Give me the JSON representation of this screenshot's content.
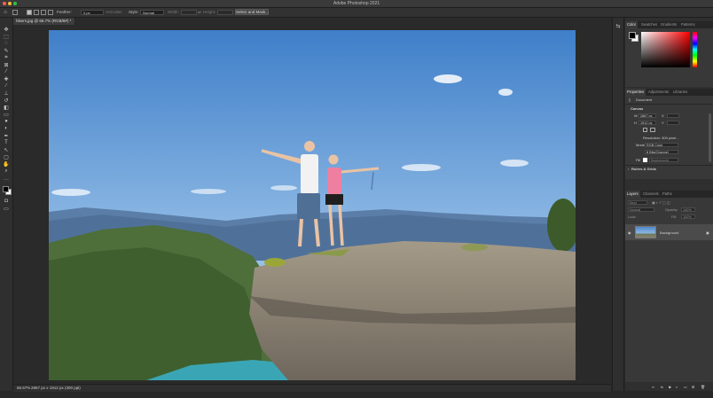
{
  "window": {
    "title": "Adobe Photoshop 2021",
    "traffic_colors": [
      "#ff5f57",
      "#febc2e",
      "#28c840"
    ]
  },
  "options_bar": {
    "feather_label": "Feather:",
    "feather_value": "0 px",
    "anti_alias_label": "Anti-alias",
    "style_label": "Style:",
    "style_value": "Normal",
    "width_label": "Width:",
    "height_label": "Height:",
    "select_and_mask_label": "Select and Mask..."
  },
  "document": {
    "tab_label": "hikers.jpg @ 66.7% (RGB/8#) *",
    "zoom": "66.67%",
    "status_info": "2867 px x 1912 px (300 ppi)"
  },
  "color_panel": {
    "tabs": [
      "Color",
      "Swatches",
      "Gradients",
      "Patterns"
    ],
    "active_tab": "Color",
    "foreground": "#000000",
    "background": "#ffffff",
    "hue": "#ff0000"
  },
  "properties_panel": {
    "tabs": [
      "Properties",
      "Adjustments",
      "Libraries"
    ],
    "active_tab": "Properties",
    "type_label": "Document",
    "canvas_section": "Canvas",
    "w_label": "W",
    "w_value": "2867 px",
    "h_label": "H",
    "h_value": "1912 px",
    "x_label": "X",
    "y_label": "Y",
    "resolution": "Resolution: 300 pixel...",
    "mode_label": "Mode",
    "mode_value": "RGB Color",
    "bits_value": "8 Bits/Channel",
    "fill_label": "Fill",
    "fill_value": "Background",
    "rulers_section": "Rulers & Grids"
  },
  "layers_panel": {
    "tabs": [
      "Layers",
      "Channels",
      "Paths"
    ],
    "active_tab": "Layers",
    "kind_placeholder": "Kind",
    "blend_mode": "Normal",
    "opacity_label": "Opacity:",
    "opacity_value": "100%",
    "lock_label": "Lock:",
    "fill_label": "Fill:",
    "fill_value": "100%",
    "layers": [
      {
        "name": "Background",
        "visible": true,
        "locked": true
      }
    ]
  }
}
